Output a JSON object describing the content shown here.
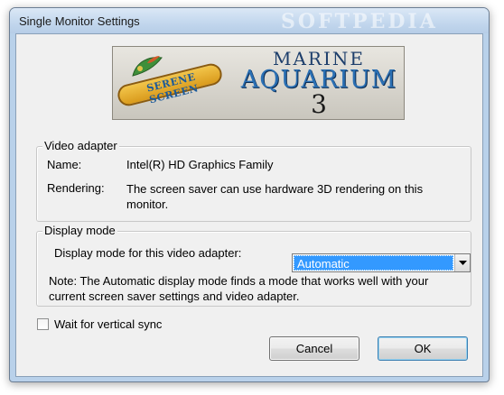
{
  "window": {
    "title": "Single Monitor Settings",
    "watermark": "SOFTPEDIA"
  },
  "banner": {
    "logo_text": "SERENE SCREEN",
    "product_line1": "MARINE",
    "product_line2": "AQUARIUM",
    "product_line3": "3"
  },
  "video_adapter": {
    "legend": "Video adapter",
    "name_label": "Name:",
    "name_value": "Intel(R) HD Graphics Family",
    "rendering_label": "Rendering:",
    "rendering_value": "The screen saver can use hardware 3D rendering on this monitor."
  },
  "display_mode": {
    "legend": "Display mode",
    "select_label": "Display mode for this video adapter:",
    "selected_value": "Automatic",
    "note": "Note: The Automatic display mode finds a mode that works well with your current screen saver settings and video adapter."
  },
  "vsync": {
    "label": "Wait for vertical sync",
    "checked": false
  },
  "buttons": {
    "cancel": "Cancel",
    "ok": "OK"
  },
  "icons": {
    "dropdown": "chevron-down-icon",
    "logo_leaf": "leaf-icon"
  }
}
